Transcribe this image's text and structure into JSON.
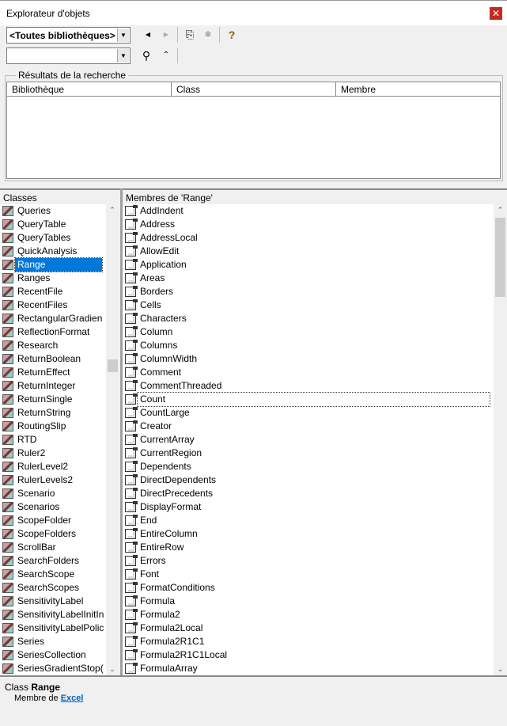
{
  "window": {
    "title": "Explorateur d'objets",
    "close_icon": "close-icon"
  },
  "toolbar": {
    "library_combo": "<Toutes bibliothèques>",
    "search_combo": "",
    "icons": [
      "back-icon",
      "forward-icon",
      "copy-icon",
      "view-definition-icon",
      "help-icon",
      "search-icon",
      "collapse-icon"
    ]
  },
  "search_results": {
    "label": "Résultats de la recherche",
    "columns": [
      "Bibliothèque",
      "Class",
      "Membre"
    ]
  },
  "classes": {
    "header": "Classes",
    "selected": "Range",
    "items": [
      "Queries",
      "QueryTable",
      "QueryTables",
      "QuickAnalysis",
      "Range",
      "Ranges",
      "RecentFile",
      "RecentFiles",
      "RectangularGradien",
      "ReflectionFormat",
      "Research",
      "ReturnBoolean",
      "ReturnEffect",
      "ReturnInteger",
      "ReturnSingle",
      "ReturnString",
      "RoutingSlip",
      "RTD",
      "Ruler2",
      "RulerLevel2",
      "RulerLevels2",
      "Scenario",
      "Scenarios",
      "ScopeFolder",
      "ScopeFolders",
      "ScrollBar",
      "SearchFolders",
      "SearchScope",
      "SearchScopes",
      "SensitivityLabel",
      "SensitivityLabelInitIn",
      "SensitivityLabelPolic",
      "Series",
      "SeriesCollection",
      "SeriesGradientStop("
    ]
  },
  "members": {
    "header": "Membres de 'Range'",
    "focused": "Count",
    "items": [
      "AddIndent",
      "Address",
      "AddressLocal",
      "AllowEdit",
      "Application",
      "Areas",
      "Borders",
      "Cells",
      "Characters",
      "Column",
      "Columns",
      "ColumnWidth",
      "Comment",
      "CommentThreaded",
      "Count",
      "CountLarge",
      "Creator",
      "CurrentArray",
      "CurrentRegion",
      "Dependents",
      "DirectDependents",
      "DirectPrecedents",
      "DisplayFormat",
      "End",
      "EntireColumn",
      "EntireRow",
      "Errors",
      "Font",
      "FormatConditions",
      "Formula",
      "Formula2",
      "Formula2Local",
      "Formula2R1C1",
      "Formula2R1C1Local",
      "FormulaArray"
    ]
  },
  "details": {
    "prefix": "Class",
    "name": "Range",
    "member_of": "Membre de",
    "library": "Excel"
  }
}
